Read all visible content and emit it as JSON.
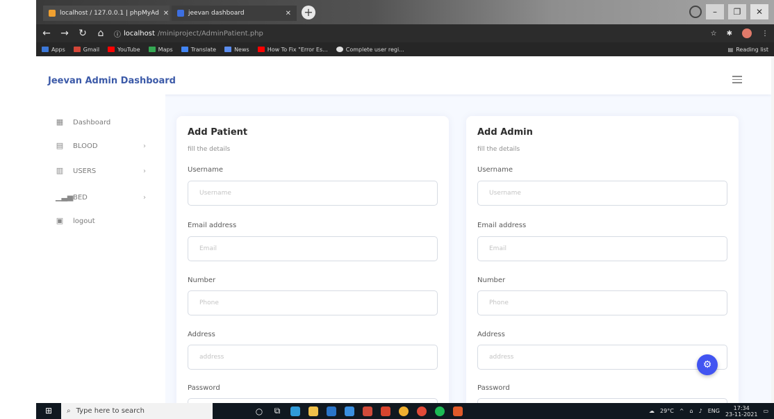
{
  "browser": {
    "tabs": [
      {
        "label": "localhost / 127.0.0.1 | phpMyAd",
        "active": false
      },
      {
        "label": "jeevan dashboard",
        "active": true
      }
    ],
    "url_host": "localhost",
    "url_path": "/miniproject/AdminPatient.php",
    "bookmarks": [
      "Apps",
      "Gmail",
      "YouTube",
      "Maps",
      "Translate",
      "News",
      "How To Fix \"Error Es...",
      "Complete user regi..."
    ],
    "reading_list": "Reading list"
  },
  "app": {
    "brand": "Jeevan Admin Dashboard",
    "sidebar": {
      "items": [
        {
          "label": "Dashboard",
          "icon": "grid-icon",
          "has_submenu": false
        },
        {
          "label": "BLOOD",
          "icon": "calendar-icon",
          "has_submenu": true
        },
        {
          "label": "USERS",
          "icon": "table-icon",
          "has_submenu": true
        },
        {
          "label": "BED",
          "icon": "bar-chart-icon",
          "has_submenu": true
        },
        {
          "label": "logout",
          "icon": "logout-icon",
          "has_submenu": false
        }
      ]
    },
    "forms": [
      {
        "title": "Add Patient",
        "subtitle": "fill the details",
        "fields": [
          {
            "label": "Username",
            "placeholder": "Username",
            "value": ""
          },
          {
            "label": "Email address",
            "placeholder": "Email",
            "value": ""
          },
          {
            "label": "Number",
            "placeholder": "Phone",
            "value": ""
          },
          {
            "label": "Address",
            "placeholder": "address",
            "value": ""
          },
          {
            "label": "Password",
            "placeholder": "",
            "value": ""
          }
        ]
      },
      {
        "title": "Add Admin",
        "subtitle": "fill the details",
        "fields": [
          {
            "label": "Username",
            "placeholder": "Username",
            "value": ""
          },
          {
            "label": "Email address",
            "placeholder": "Email",
            "value": ""
          },
          {
            "label": "Number",
            "placeholder": "Phone",
            "value": ""
          },
          {
            "label": "Address",
            "placeholder": "address",
            "value": ""
          },
          {
            "label": "Password",
            "placeholder": "",
            "value": ""
          }
        ]
      }
    ]
  },
  "taskbar": {
    "search_placeholder": "Type here to search",
    "weather": "29°C",
    "language": "ENG",
    "time": "17:34",
    "date": "23-11-2021"
  },
  "colors": {
    "brand": "#3c5aa8",
    "fab": "#4154f1",
    "page_background": "#f6f9ff"
  }
}
